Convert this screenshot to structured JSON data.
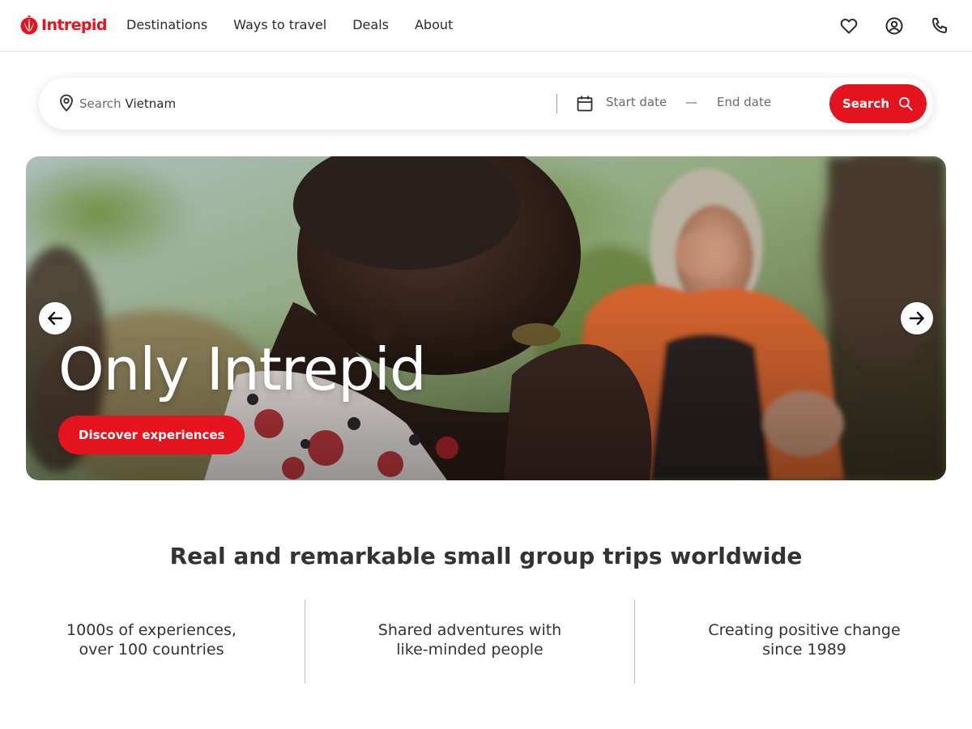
{
  "brand": {
    "name": "Intrepid",
    "color": "#e3141f"
  },
  "nav": {
    "items": [
      {
        "label": "Destinations"
      },
      {
        "label": "Ways to travel"
      },
      {
        "label": "Deals"
      },
      {
        "label": "About"
      }
    ]
  },
  "header_icons": [
    "heart-icon",
    "account-icon",
    "phone-icon"
  ],
  "search": {
    "prefix": "Search",
    "value": "Vietnam",
    "start_date_placeholder": "Start date",
    "date_separator": "—",
    "end_date_placeholder": "End date",
    "button_label": "Search"
  },
  "hero": {
    "title": "Only Intrepid",
    "cta_label": "Discover experiences",
    "prev_icon": "arrow-left-icon",
    "next_icon": "arrow-right-icon"
  },
  "intro": {
    "tagline": "Real and remarkable small group trips worldwide",
    "features": [
      {
        "line1": "1000s of experiences,",
        "line2": "over 100 countries"
      },
      {
        "line1": "Shared adventures with",
        "line2": "like-minded people"
      },
      {
        "line1": "Creating positive change",
        "line2": "since 1989"
      }
    ]
  }
}
